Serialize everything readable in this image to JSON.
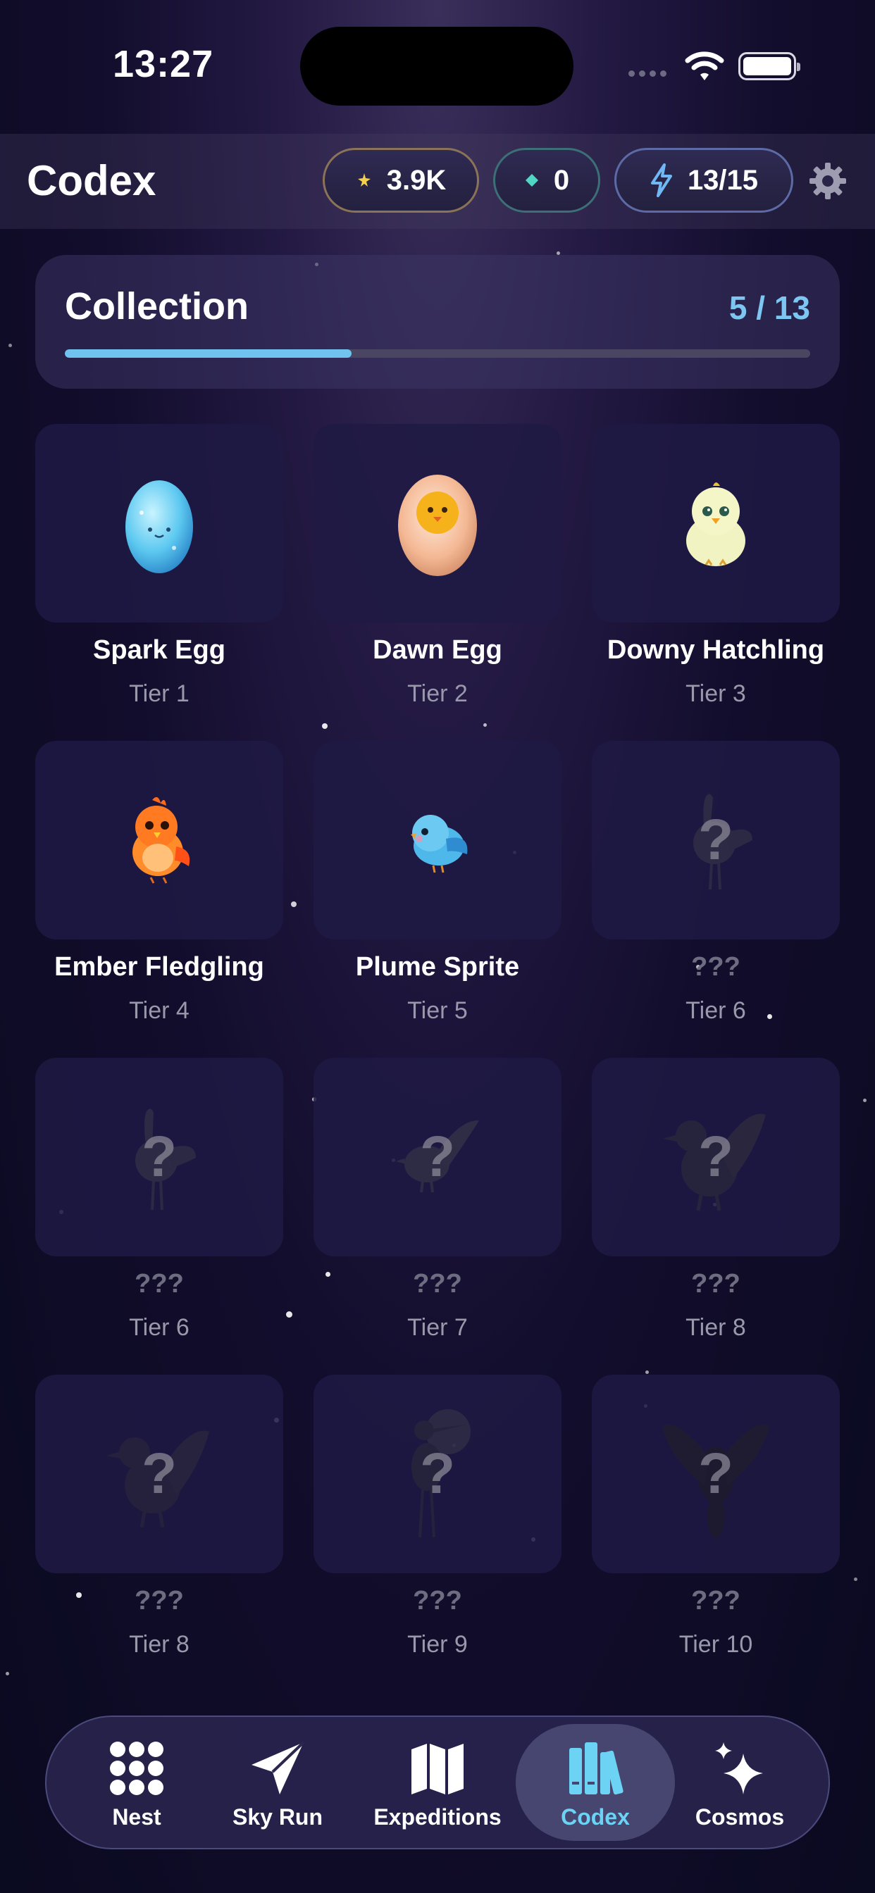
{
  "status_bar": {
    "time": "13:27"
  },
  "header": {
    "title": "Codex",
    "coins": "3.9K",
    "gems": "0",
    "energy": "13/15",
    "icons": [
      "coin-icon",
      "gem-icon",
      "lightning-icon",
      "gear-icon"
    ]
  },
  "collection": {
    "title": "Collection",
    "count": "5 / 13",
    "progress": 0.385,
    "accent_color": "#6fc3ee"
  },
  "creatures": [
    {
      "name": "Spark Egg",
      "tier": "Tier 1",
      "locked": false,
      "icon": "spark-egg-icon"
    },
    {
      "name": "Dawn Egg",
      "tier": "Tier 2",
      "locked": false,
      "icon": "dawn-egg-icon"
    },
    {
      "name": "Downy Hatchling",
      "tier": "Tier 3",
      "locked": false,
      "icon": "downy-hatchling-icon"
    },
    {
      "name": "Ember Fledgling",
      "tier": "Tier 4",
      "locked": false,
      "icon": "ember-fledgling-icon"
    },
    {
      "name": "Plume Sprite",
      "tier": "Tier 5",
      "locked": false,
      "icon": "plume-sprite-icon"
    },
    {
      "name": "???",
      "tier": "Tier 6",
      "locked": true,
      "icon": "locked-bird-icon"
    },
    {
      "name": "???",
      "tier": "Tier 6",
      "locked": true,
      "icon": "locked-bird-icon"
    },
    {
      "name": "???",
      "tier": "Tier 7",
      "locked": true,
      "icon": "locked-bird-icon"
    },
    {
      "name": "???",
      "tier": "Tier 8",
      "locked": true,
      "icon": "locked-bird-icon"
    },
    {
      "name": "???",
      "tier": "Tier 8",
      "locked": true,
      "icon": "locked-bird-icon"
    },
    {
      "name": "???",
      "tier": "Tier 9",
      "locked": true,
      "icon": "locked-bird-icon"
    },
    {
      "name": "???",
      "tier": "Tier 10",
      "locked": true,
      "icon": "locked-bird-icon"
    }
  ],
  "nav": [
    {
      "label": "Nest",
      "icon": "grid-dots-icon",
      "active": false
    },
    {
      "label": "Sky Run",
      "icon": "paper-plane-icon",
      "active": false
    },
    {
      "label": "Expeditions",
      "icon": "map-icon",
      "active": false
    },
    {
      "label": "Codex",
      "icon": "books-icon",
      "active": true
    },
    {
      "label": "Cosmos",
      "icon": "sparkles-icon",
      "active": false
    }
  ]
}
